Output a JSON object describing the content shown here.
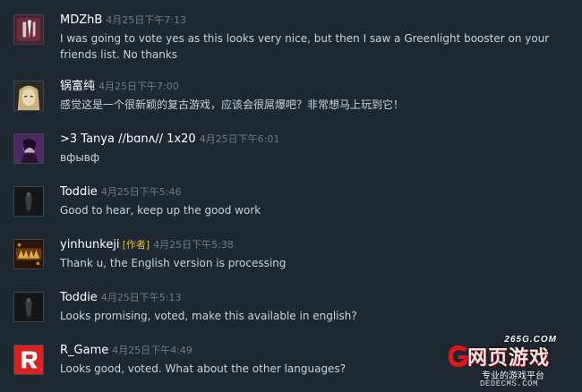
{
  "comments": [
    {
      "author": "MDZhB",
      "author_tag": "",
      "timestamp": "4月25日下午7:13",
      "text": "I was going to vote yes as this looks very nice, but then I saw a Greenlight booster on your friends list. No thanks",
      "avatar_icon": "sword-emblem-avatar"
    },
    {
      "author": "锅富纯",
      "author_tag": "",
      "timestamp": "4月25日下午7:00",
      "text": "感觉这是一个很新颖的复古游戏，应该会很屌爆吧？非常想马上玩到它！",
      "avatar_icon": "blonde-face-avatar"
    },
    {
      "author": ">3 Tanya //bɑnʌ// 1x20",
      "author_tag": "",
      "timestamp": "4月25日下午6:01",
      "text": "вфывф",
      "avatar_icon": "purple-portrait-avatar"
    },
    {
      "author": "Toddie",
      "author_tag": "",
      "timestamp": "4月25日下午5:46",
      "text": "Good to hear, keep up the good work",
      "avatar_icon": "dark-figure-avatar"
    },
    {
      "author": "yinhunkeji",
      "author_tag": "[作者]",
      "timestamp": "4月25日下午5:38",
      "text": "Thank u, the English version is processing",
      "avatar_icon": "golden-logo-avatar"
    },
    {
      "author": "Toddie",
      "author_tag": "",
      "timestamp": "4月25日下午5:13",
      "text": "Looks promising, voted, make this available in english?",
      "avatar_icon": "dark-figure-avatar"
    },
    {
      "author": "R_Game",
      "author_tag": "",
      "timestamp": "4月25日下午4:49",
      "text": "Looks good, voted. What about the other languages?",
      "avatar_icon": "red-r-logo-avatar"
    }
  ],
  "watermark": {
    "site": "265G.COM",
    "title": "网页游戏",
    "subtitle": "专业的游戏平台",
    "domain": "DEDECMS.COM"
  },
  "colors": {
    "background": "#1e2832",
    "author": "#ffffff",
    "timestamp": "#6f7b86",
    "text": "#c6d3dd",
    "author_tag": "#e0c234"
  }
}
